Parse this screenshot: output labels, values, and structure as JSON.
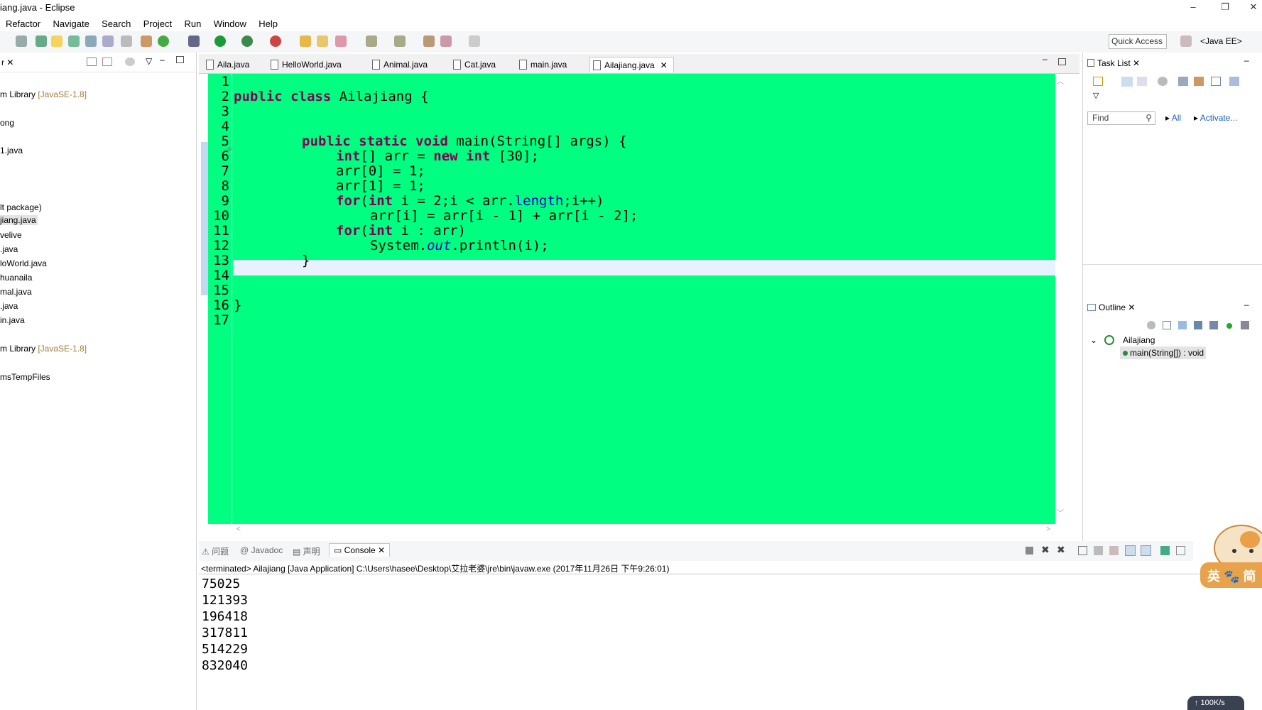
{
  "window": {
    "title": "iang.java - Eclipse",
    "buttons": {
      "minimize": "–",
      "restore": "❐",
      "close": "✕"
    }
  },
  "menu": [
    "Refactor",
    "Navigate",
    "Search",
    "Project",
    "Run",
    "Window",
    "Help"
  ],
  "toolbar": {
    "quick_access": "Quick Access",
    "perspective": "<Java EE>"
  },
  "explorer": {
    "items": [
      {
        "text": "m Library ",
        "suffix": "[JavaSE-1.8]"
      },
      {
        "text": "ong",
        "suffix": ""
      },
      {
        "text": "1.java",
        "suffix": ""
      },
      {
        "text": "lt package)",
        "suffix": ""
      },
      {
        "text": "jiang.java",
        "suffix": ""
      },
      {
        "text": "velive",
        "suffix": ""
      },
      {
        "text": ".java",
        "suffix": ""
      },
      {
        "text": "loWorld.java",
        "suffix": ""
      },
      {
        "text": "huanaila",
        "suffix": ""
      },
      {
        "text": "mal.java",
        "suffix": ""
      },
      {
        "text": ".java",
        "suffix": ""
      },
      {
        "text": "in.java",
        "suffix": ""
      },
      {
        "text": "m Library ",
        "suffix": "[JavaSE-1.8]"
      },
      {
        "text": "msTempFiles",
        "suffix": ""
      }
    ]
  },
  "editor": {
    "tabs": [
      "Aila.java",
      "HelloWorld.java",
      "Animal.java",
      "Cat.java",
      "main.java",
      "Ailajiang.java"
    ],
    "active_tab": "Ailajiang.java",
    "line_numbers": [
      "1",
      "2",
      "3",
      "4",
      "5",
      "6",
      "7",
      "8",
      "9",
      "10",
      "11",
      "12",
      "13",
      "14",
      "15",
      "16",
      "17"
    ],
    "code": {
      "l2_kw": "public class",
      "l2_rest": " Ailajiang {",
      "l5_kw": "public static void",
      "l5_rest": " main(String[] args) {",
      "l6_kw1": "int",
      "l6_mid": "[] arr = ",
      "l6_kw2": "new int",
      "l6_rest": " [30];",
      "l7": "arr[0] = 1;",
      "l8": "arr[1] = 1;",
      "l9_kw1": "for",
      "l9_a": "(",
      "l9_kw2": "int",
      "l9_b": " i = 2;i < arr.",
      "l9_fld": "length",
      "l9_c": ";i++)",
      "l10": "arr[i] = arr[i - 1] + arr[i - 2];",
      "l11_kw1": "for",
      "l11_a": "(",
      "l11_kw2": "int",
      "l11_b": " i : arr)",
      "l12_a": "System.",
      "l12_fld": "out",
      "l12_b": ".println(i);",
      "l13": "}",
      "l16": "}"
    }
  },
  "task_list": {
    "title": "Task List",
    "find_placeholder": "Find",
    "all": "All",
    "activate": "Activate..."
  },
  "outline": {
    "title": "Outline",
    "class_name": "Ailajiang",
    "method": "main(String[]) : void"
  },
  "console": {
    "tabs": [
      "问题",
      "Javadoc",
      "声明",
      "Console"
    ],
    "active_tab": "Console",
    "terminated": "<terminated> Ailajiang [Java Application] C:\\Users\\hasee\\Desktop\\艾拉老婆\\jre\\bin\\javaw.exe (2017年11月26日 下午9:26:01)",
    "output": [
      "75025",
      "121393",
      "196418",
      "317811",
      "514229",
      "832040"
    ]
  },
  "overlay": {
    "mascot_label": "英 🐾 简",
    "net_speed": "↑ 100K/s"
  }
}
